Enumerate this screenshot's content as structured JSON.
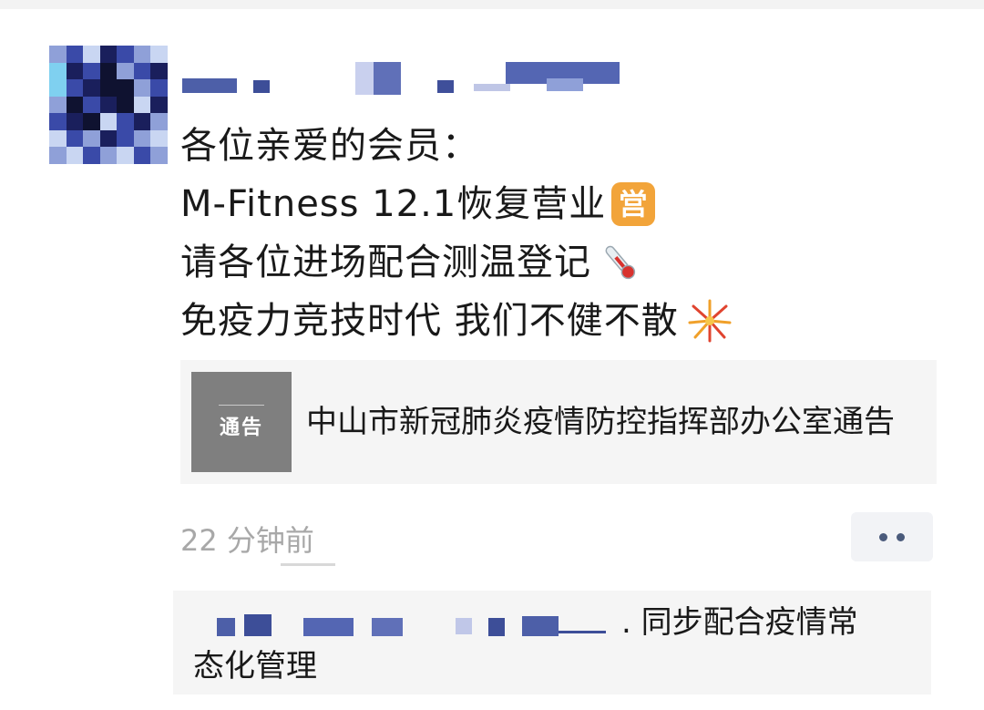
{
  "post": {
    "lines": [
      "各位亲爱的会员：",
      "M-Fitness 12.1恢复营业",
      "请各位进场配合测温登记",
      "免疫力竞技时代 我们不健不散"
    ],
    "emoji": {
      "line2": "営",
      "line2_icon": "ying-business-emoji-icon",
      "line3_icon": "thermometer-emoji-icon",
      "line4_icon": "fireworks-emoji-icon"
    }
  },
  "link_card": {
    "thumb_label": "通告",
    "title": "中山市新冠肺炎疫情防控指挥部办公室通告"
  },
  "meta": {
    "time": "22 分钟前",
    "more_icon": "more-dots-icon"
  },
  "comment": {
    "text_part1": ". 同步配合疫情常",
    "text_part2": "态化管理"
  },
  "colors": {
    "text": "#191919",
    "muted": "#a8a8a8",
    "card_bg": "#f5f5f5",
    "more_dots": "#4a5a7b",
    "avatar_palette": [
      "#1a1f5c",
      "#3a4aa8",
      "#8fa0d8",
      "#c9d6f2",
      "#7fd0f0",
      "#0f1230"
    ]
  }
}
